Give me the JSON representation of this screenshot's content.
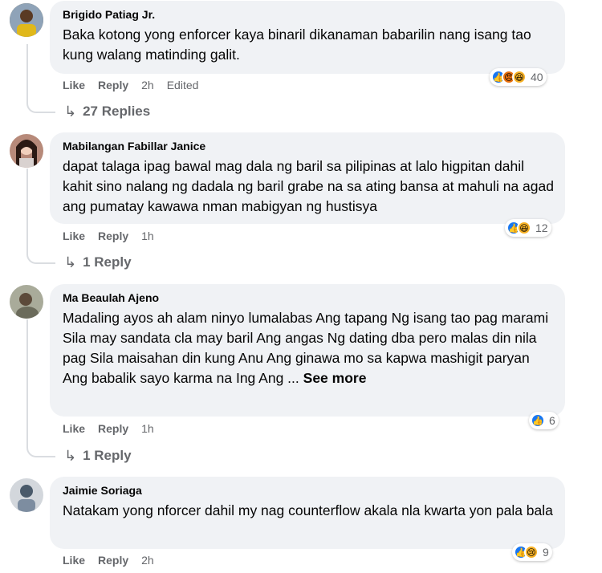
{
  "comments": [
    {
      "author": "Brigido Patiag Jr.",
      "text": "Baka kotong yong enforcer kaya binaril dikanaman babarilin nang isang tao kung walang matinding galit.",
      "like_label": "Like",
      "reply_label": "Reply",
      "time": "2h",
      "edited": "Edited",
      "reaction_count": "40",
      "reaction_icons": [
        "like-icon",
        "angry-icon",
        "haha-icon"
      ],
      "replies_label": "27 Replies"
    },
    {
      "author": "Mabilangan Fabillar Janice",
      "text": "dapat talaga ipag bawal mag dala ng baril sa pilipinas at lalo higpitan dahil kahit sino nalang ng dadala ng baril grabe na sa ating bansa at mahuli na agad ang pumatay kawawa nman mabigyan ng hustisya",
      "like_label": "Like",
      "reply_label": "Reply",
      "time": "1h",
      "reaction_count": "12",
      "reaction_icons": [
        "like-icon",
        "haha-icon"
      ],
      "replies_label": "1 Reply"
    },
    {
      "author": "Ma Beaulah Ajeno",
      "text": "Madaling ayos ah alam ninyo lumalabas Ang tapang Ng isang tao pag marami Sila may sandata cla may baril Ang angas Ng dating dba pero malas din nila pag Sila maisahan din kung Anu Ang ginawa mo sa kapwa mashigit paryan Ang babalik sayo karma na Ing Ang ...",
      "see_more": "See more",
      "like_label": "Like",
      "reply_label": "Reply",
      "time": "1h",
      "reaction_count": "6",
      "reaction_icons": [
        "like-icon"
      ],
      "replies_label": "1 Reply"
    },
    {
      "author": "Jaimie Soriaga",
      "text": "Natakam yong nforcer dahil my nag counterflow akala nla kwarta yon pala bala",
      "like_label": "Like",
      "reply_label": "Reply",
      "time": "2h",
      "reaction_count": "9",
      "reaction_icons": [
        "like-icon",
        "sad-icon"
      ]
    }
  ],
  "colors": {
    "bubble": "#f0f2f5",
    "secondary_text": "#65676b",
    "like_blue": "#1877f2",
    "thread_line": "#dadde1"
  }
}
